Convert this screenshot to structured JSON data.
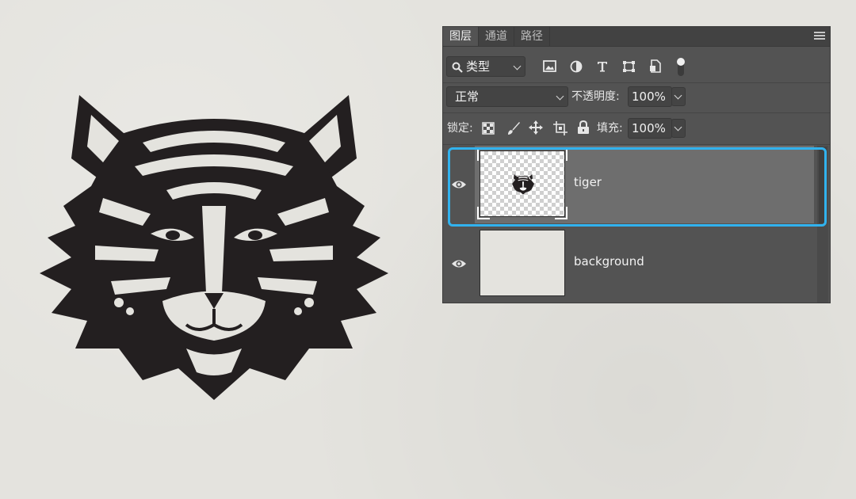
{
  "panel": {
    "tabs": [
      {
        "label": "图层",
        "active": true
      },
      {
        "label": "通道",
        "active": false
      },
      {
        "label": "路径",
        "active": false
      }
    ],
    "filter": {
      "label": "类型",
      "icon": "search-icon"
    },
    "filter_icons": [
      "image-filter-icon",
      "adjustment-filter-icon",
      "text-filter-icon",
      "shape-filter-icon",
      "smart-object-filter-icon",
      "filter-toggle-icon"
    ],
    "blend_mode": "正常",
    "opacity": {
      "label": "不透明度:",
      "value": "100%"
    },
    "lock": {
      "label": "锁定:",
      "icons": [
        "lock-transparent-pixels-icon",
        "lock-image-pixels-icon",
        "lock-position-icon",
        "lock-artboard-icon",
        "lock-all-icon"
      ]
    },
    "fill": {
      "label": "填充:",
      "value": "100%"
    },
    "layers": [
      {
        "name": "tiger",
        "visible": true,
        "selected": true
      },
      {
        "name": "background",
        "visible": true,
        "selected": false
      }
    ],
    "colors": {
      "panel_bg": "#535353",
      "selected_row": "#6e6e6e",
      "selection_outline": "#31b2ee"
    }
  },
  "canvas": {
    "background": "#e4e3de",
    "artwork": "tiger-head"
  }
}
